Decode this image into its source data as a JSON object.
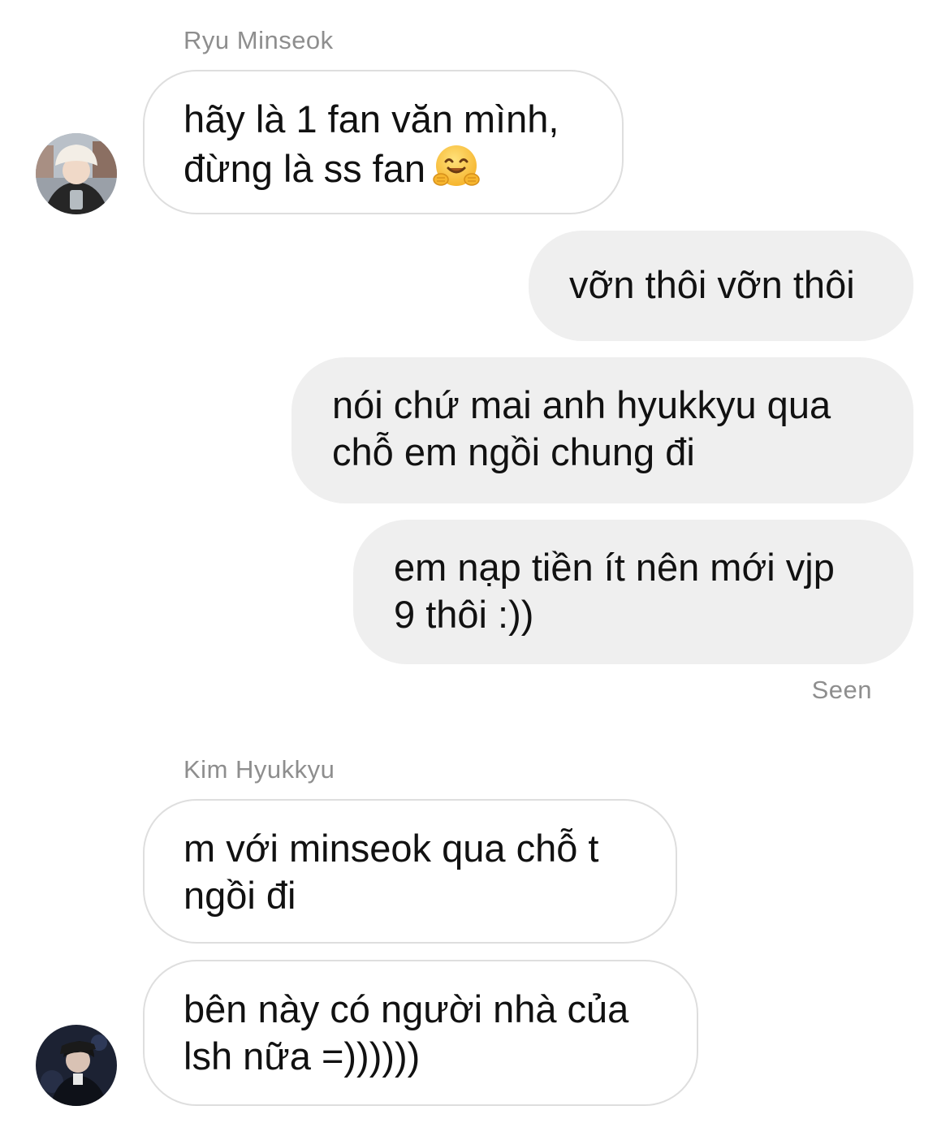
{
  "conversation": {
    "groups": [
      {
        "sender": "Ryu Minseok",
        "messages": [
          {
            "text": "hãy là 1 fan văn mình,\nđừng là ss fan",
            "emoji": "hugging-face-icon"
          }
        ]
      },
      {
        "sender": "me",
        "messages": [
          {
            "text": "vỡn thôi vỡn thôi"
          },
          {
            "text": "nói chứ mai anh hyukkyu qua\nchỗ em ngồi chung đi"
          },
          {
            "text": "em nạp tiền ít nên mới vjp\n9 thôi :))"
          }
        ],
        "status": "Seen"
      },
      {
        "sender": "Kim Hyukkyu",
        "messages": [
          {
            "text": "m với minseok qua chỗ t\nngồi đi"
          },
          {
            "text": "bên này có người nhà của\nlsh nữa =))))))"
          }
        ]
      }
    ]
  },
  "colors": {
    "incoming_border": "#dedede",
    "outgoing_bg": "#efefef",
    "meta_text": "#8e8e8e"
  }
}
